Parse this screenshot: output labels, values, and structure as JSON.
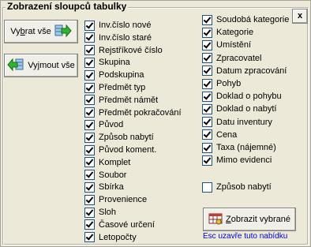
{
  "dialog": {
    "title": "Zobrazení sloupců tabulky",
    "close_label": "x"
  },
  "buttons": {
    "select_all_prefix": "Vy",
    "select_all_underline": "b",
    "select_all_suffix": "rat vše",
    "remove_all_prefix": "Vy",
    "remove_all_underline": "j",
    "remove_all_suffix": "mout vše",
    "show_selected_prefix": "",
    "show_selected_underline": "Z",
    "show_selected_suffix": "obrazit vybrané"
  },
  "columns_left": [
    {
      "label": "Inv.číslo nové",
      "checked": true
    },
    {
      "label": "Inv.číslo staré",
      "checked": true
    },
    {
      "label": "Rejstříkové číslo",
      "checked": true
    },
    {
      "label": "Skupina",
      "checked": true
    },
    {
      "label": "Podskupina",
      "checked": true
    },
    {
      "label": "Předmět typ",
      "checked": true
    },
    {
      "label": "Předmět námět",
      "checked": true
    },
    {
      "label": "Předmět pokračování",
      "checked": true
    },
    {
      "label": "Původ",
      "checked": true
    },
    {
      "label": "Způsob nabytí",
      "checked": true
    },
    {
      "label": "Původ koment.",
      "checked": true
    },
    {
      "label": "Komplet",
      "checked": true
    },
    {
      "label": "Soubor",
      "checked": true
    },
    {
      "label": "Sbírka",
      "checked": true
    },
    {
      "label": "Provenience",
      "checked": true
    },
    {
      "label": "Sloh",
      "checked": true
    },
    {
      "label": "Časové určení",
      "checked": true
    },
    {
      "label": "Letopočty",
      "checked": true
    }
  ],
  "columns_right": [
    {
      "label": "Soudobá kategorie",
      "checked": true
    },
    {
      "label": "Kategorie",
      "checked": true
    },
    {
      "label": "Umístění",
      "checked": true
    },
    {
      "label": "Zpracovatel",
      "checked": true
    },
    {
      "label": "Datum zpracování",
      "checked": true
    },
    {
      "label": "Pohyb",
      "checked": true
    },
    {
      "label": "Doklad o pohybu",
      "checked": true
    },
    {
      "label": "Doklad o nabytí",
      "checked": true
    },
    {
      "label": "Datu inventury",
      "checked": true
    },
    {
      "label": "Cena",
      "checked": true
    },
    {
      "label": "Taxa (nájemné)",
      "checked": true
    },
    {
      "label": "Mimo evidenci",
      "checked": true
    }
  ],
  "extra_option": {
    "label": "Způsob nabytí",
    "checked": false
  },
  "hint": "Esc uzavře tuto nabídku",
  "icons": {
    "select_all": "green-arrow-right-icon",
    "remove_all": "green-arrow-left-icon",
    "show_selected": "table-view-icon"
  }
}
